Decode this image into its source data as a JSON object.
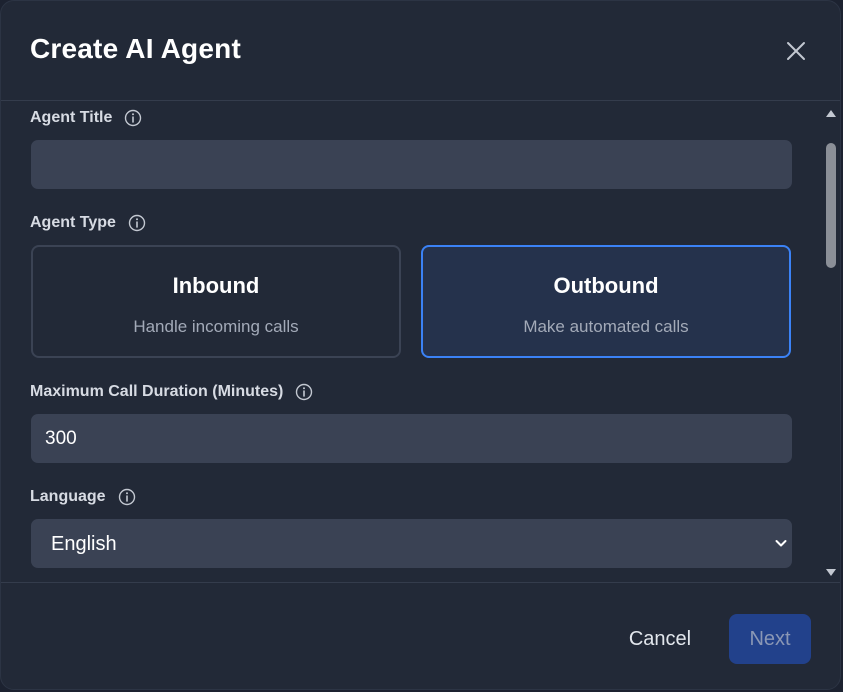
{
  "modal": {
    "title": "Create AI Agent"
  },
  "form": {
    "agent_title": {
      "label": "Agent Title",
      "value": "",
      "placeholder": ""
    },
    "agent_type": {
      "label": "Agent Type",
      "selected": "outbound",
      "options": [
        {
          "id": "inbound",
          "title": "Inbound",
          "description": "Handle incoming calls"
        },
        {
          "id": "outbound",
          "title": "Outbound",
          "description": "Make automated calls"
        }
      ]
    },
    "max_duration": {
      "label": "Maximum Call Duration (Minutes)",
      "value": "300"
    },
    "language": {
      "label": "Language",
      "value": "English"
    }
  },
  "footer": {
    "cancel_label": "Cancel",
    "next_label": "Next"
  },
  "colors": {
    "accent": "#3b82f6",
    "primary_button_disabled": "#22418b",
    "modal_background": "#222937",
    "input_background": "#3a4254"
  },
  "icons": {
    "close": "close-icon",
    "info": "info-icon",
    "dropdown": "chevron-down-icon"
  }
}
